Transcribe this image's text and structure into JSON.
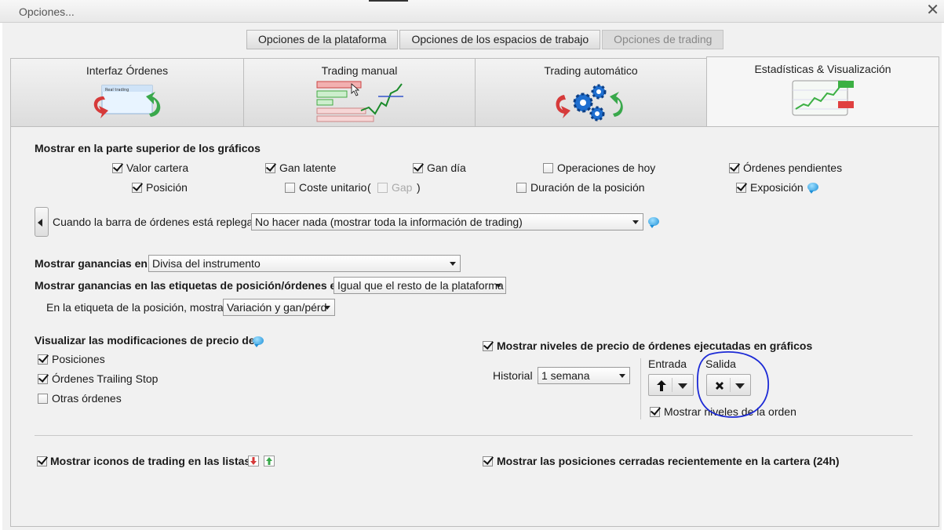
{
  "window": {
    "title": "Opciones...",
    "close_glyph": "✕"
  },
  "top_tabs": [
    {
      "label": "Opciones de la plataforma"
    },
    {
      "label": "Opciones de los espacios de trabajo"
    },
    {
      "label": "Opciones de trading"
    }
  ],
  "category_tabs": [
    {
      "label": "Interfaz Órdenes",
      "icon": "order-interface-icon"
    },
    {
      "label": "Trading manual",
      "icon": "manual-trading-icon"
    },
    {
      "label": "Trading automático",
      "icon": "automatic-trading-icon"
    },
    {
      "label": "Estadísticas & Visualización",
      "icon": "statistics-chart-icon"
    }
  ],
  "show_top": {
    "heading": "Mostrar en la parte superior de los gráficos",
    "items": [
      {
        "label": "Valor cartera",
        "checked": true
      },
      {
        "label": "Gan latente",
        "checked": true
      },
      {
        "label": "Gan día",
        "checked": true
      },
      {
        "label": "Operaciones de hoy",
        "checked": false
      },
      {
        "label": "Órdenes pendientes",
        "checked": true
      },
      {
        "label": "Posición",
        "checked": true
      },
      {
        "label": "Coste unitario",
        "checked": false
      },
      {
        "label": "Gap",
        "checked": false,
        "disabled": true
      },
      {
        "label": "Duración de la posición",
        "checked": false
      },
      {
        "label": "Exposición",
        "checked": true
      }
    ],
    "paren_open": "(",
    "paren_close": ")"
  },
  "collapsed_bar": {
    "label": "Cuando la barra de órdenes está replegada",
    "value": "No hacer nada (mostrar toda la información de trading)"
  },
  "gains": {
    "label": "Mostrar ganancias en:",
    "value": "Divisa del instrumento",
    "labels_label": "Mostrar ganancias en las etiquetas de posición/órdenes en:",
    "labels_value": "Igual que el resto de la plataforma",
    "position_label": "En la etiqueta de la posición, mostrar:",
    "position_value": "Variación y gan/pérd"
  },
  "price_mods": {
    "heading": "Visualizar las modificaciones de precio de:",
    "items": [
      {
        "label": "Posiciones",
        "checked": true
      },
      {
        "label": "Órdenes Trailing Stop",
        "checked": true
      },
      {
        "label": "Otras órdenes",
        "checked": false
      }
    ]
  },
  "executed_levels": {
    "label": "Mostrar niveles de precio de órdenes ejecutadas en gráficos",
    "checked": true,
    "history_label": "Historial",
    "history_value": "1 semana",
    "entry_label": "Entrada",
    "entry_icon": "arrow-up-icon",
    "exit_label": "Salida",
    "exit_icon": "x-icon",
    "order_levels_label": "Mostrar niveles de la orden",
    "order_levels_checked": true
  },
  "footer": {
    "trading_icons_label": "Mostrar iconos de trading en las listas",
    "trading_icons_checked": true,
    "closed_positions_label": "Mostrar las posiciones cerradas recientemente en la cartera (24h)",
    "closed_positions_checked": true
  },
  "colors": {
    "annotation_circle": "#1c2ad6",
    "chart_green": "#3cb043",
    "chart_red": "#e04040"
  }
}
